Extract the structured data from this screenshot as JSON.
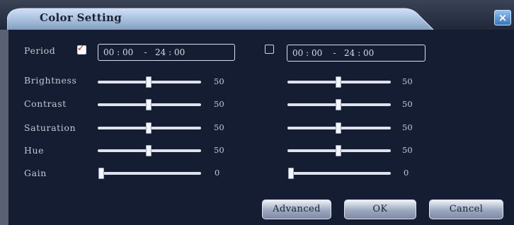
{
  "dialog": {
    "title": "Color Setting",
    "close_label": "×"
  },
  "period": {
    "label": "Period",
    "schedule1": {
      "checked": true,
      "start": "00 : 00",
      "separator": "-",
      "end": "24 : 00"
    },
    "schedule2": {
      "checked": false,
      "start": "00 : 00",
      "separator": "-",
      "end": "24 : 00"
    }
  },
  "sliders": [
    {
      "label": "Brightness",
      "value1": "50",
      "value2": "50"
    },
    {
      "label": "Contrast",
      "value1": "50",
      "value2": "50"
    },
    {
      "label": "Saturation",
      "value1": "50",
      "value2": "50"
    },
    {
      "label": "Hue",
      "value1": "50",
      "value2": "50"
    },
    {
      "label": "Gain",
      "value1": "0",
      "value2": "0"
    }
  ],
  "buttons": {
    "advanced": "Advanced",
    "ok": "OK",
    "cancel": "Cancel"
  }
}
